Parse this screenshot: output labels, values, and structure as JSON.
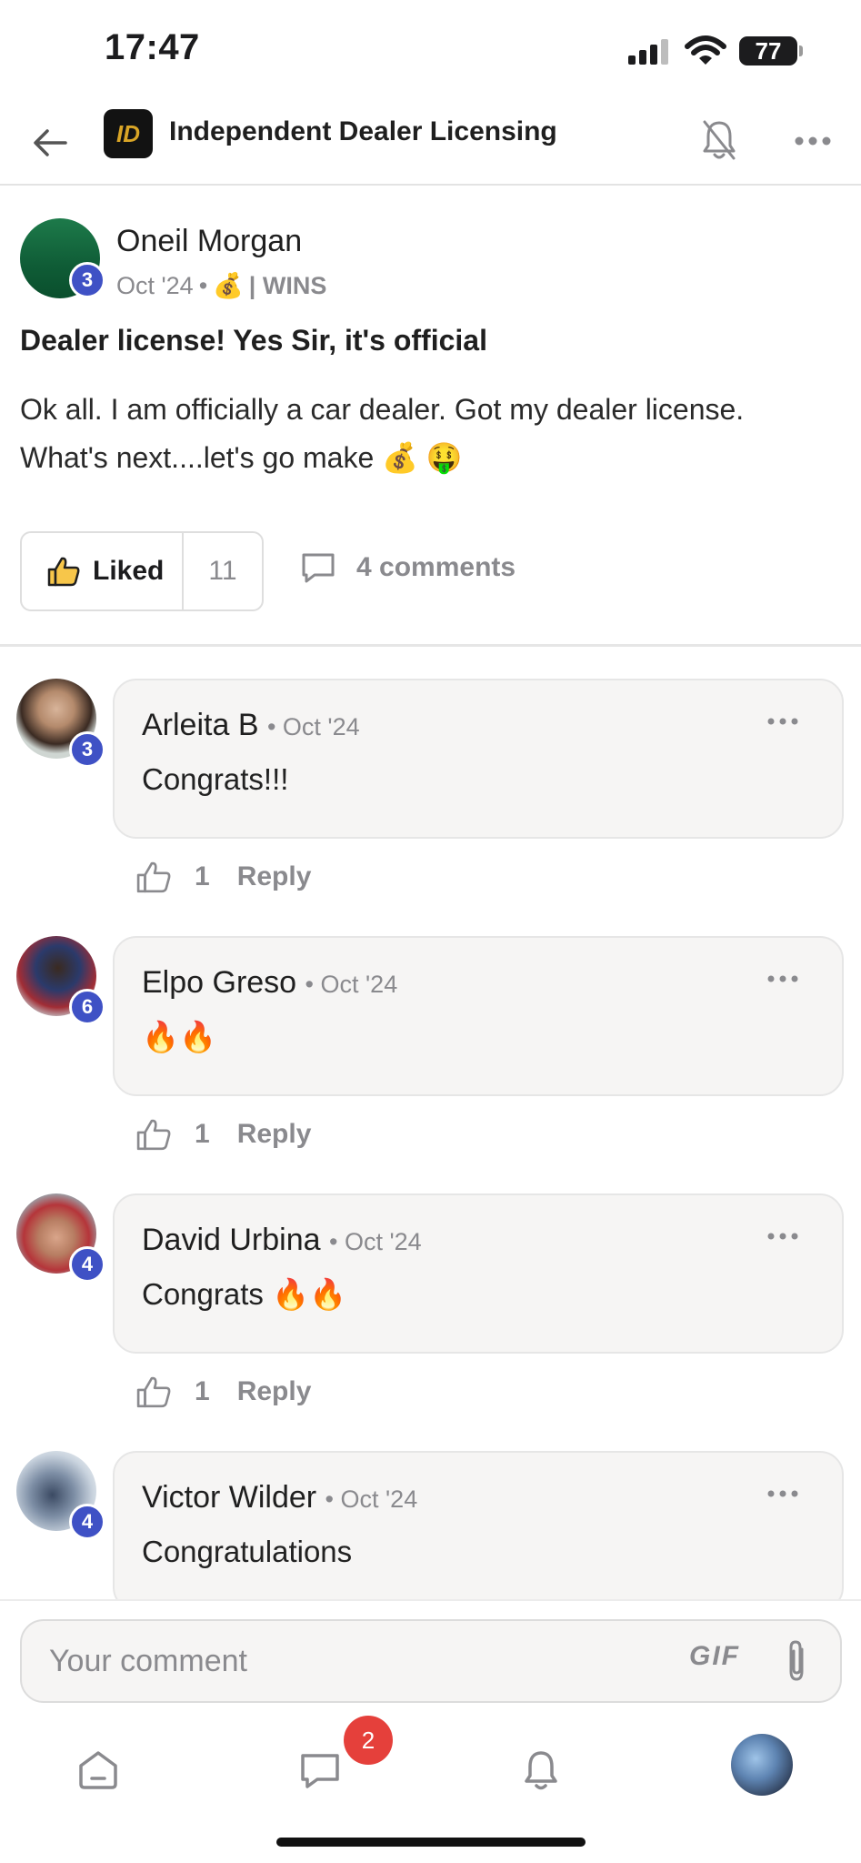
{
  "status_bar": {
    "time": "17:47",
    "battery": "77"
  },
  "header": {
    "group_logo_text": "ID",
    "group_name": "Independent Dealer Licensing"
  },
  "post": {
    "author": "Oneil Morgan",
    "level": "3",
    "date": "Oct '24",
    "category": "| WINS",
    "title": "Dealer license! Yes Sir, it's official",
    "body": "Ok all. I am officially a car dealer. Got my dealer license. What's next....let's go make 💰 🤑",
    "meta_emoji": "💰",
    "liked_label": "Liked",
    "like_count": "11",
    "comments_label": "4 comments"
  },
  "comments": [
    {
      "author": "Arleita B",
      "date": "Oct '24",
      "level": "3",
      "text": "Congrats!!!",
      "likes": "1",
      "reply": "Reply"
    },
    {
      "author": "Elpo Greso",
      "date": "Oct '24",
      "level": "6",
      "text": "🔥🔥",
      "likes": "1",
      "reply": "Reply"
    },
    {
      "author": "David Urbina",
      "date": "Oct '24",
      "level": "4",
      "text": "Congrats 🔥🔥",
      "likes": "1",
      "reply": "Reply"
    },
    {
      "author": "Victor Wilder",
      "date": "Oct '24",
      "level": "4",
      "text": "Congratulations",
      "likes": "",
      "reply": ""
    }
  ],
  "composer": {
    "placeholder": "Your comment",
    "gif_label": "GIF"
  },
  "bottom_nav": {
    "chat_badge": "2"
  },
  "colors": {
    "accent_badge": "#3f51c5",
    "notification_badge": "#e5403b",
    "bubble_bg": "#f6f5f4"
  }
}
